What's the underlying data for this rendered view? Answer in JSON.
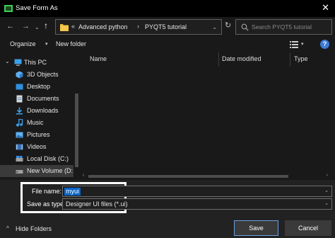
{
  "window": {
    "title": "Save Form As",
    "close_glyph": "✕"
  },
  "navigation": {
    "back_glyph": "←",
    "forward_glyph": "→",
    "dropdown_glyph": "⌄",
    "up_glyph": "↑",
    "breadcrumb": {
      "separator": "«",
      "items": [
        "Advanced python",
        "PYQT5 tutorial"
      ],
      "arrow": "›"
    },
    "refresh_glyph": "↻",
    "search_placeholder": "Search PYQT5 tutorial"
  },
  "toolbar": {
    "organize_label": "Organize",
    "organize_caret": "▾",
    "new_folder_label": "New folder",
    "view_caret": "▾",
    "help_glyph": "?"
  },
  "sidebar": {
    "items": [
      {
        "label": "This PC",
        "icon": "computer-icon",
        "expander": "⌄"
      },
      {
        "label": "3D Objects",
        "icon": "cube-icon"
      },
      {
        "label": "Desktop",
        "icon": "desktop-icon"
      },
      {
        "label": "Documents",
        "icon": "document-icon"
      },
      {
        "label": "Downloads",
        "icon": "download-icon"
      },
      {
        "label": "Music",
        "icon": "music-icon"
      },
      {
        "label": "Pictures",
        "icon": "picture-icon"
      },
      {
        "label": "Videos",
        "icon": "video-icon"
      },
      {
        "label": "Local Disk (C:)",
        "icon": "disk-icon"
      },
      {
        "label": "New Volume (D:",
        "icon": "disk-icon",
        "selected": true
      }
    ]
  },
  "filelist": {
    "columns": [
      "Name",
      "Date modified",
      "Type"
    ],
    "scroll_left": "‹",
    "scroll_right": "›"
  },
  "form": {
    "file_name_label": "File name:",
    "file_name_value": "myui",
    "save_as_type_label": "Save as type:",
    "save_as_type_value": "Designer UI files (*.ui)",
    "dropdown_caret": "⌄"
  },
  "footer": {
    "hide_folders_caret": "^",
    "hide_folders_label": "Hide Folders",
    "save_label": "Save",
    "cancel_label": "Cancel"
  },
  "colors": {
    "accent": "#0a64c8",
    "folder": "#e8b93a",
    "background": "#191919"
  }
}
